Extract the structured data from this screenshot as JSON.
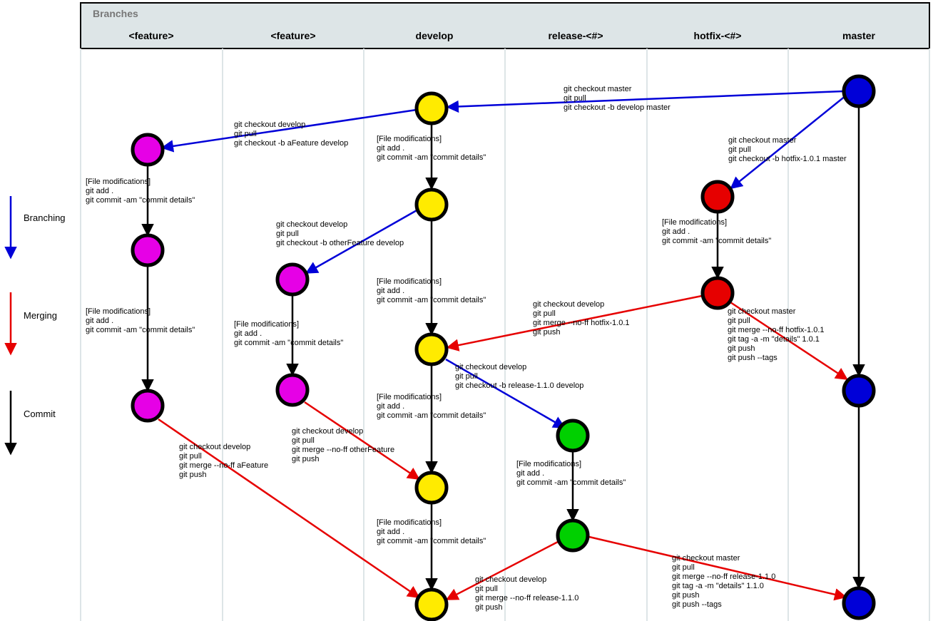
{
  "header_title": "Branches",
  "columns": [
    "<feature>",
    "<feature>",
    "develop",
    "release-<#>",
    "hotfix-<#>",
    "master"
  ],
  "legend": {
    "branching": "Branching",
    "merging": "Merging",
    "commit": "Commit"
  },
  "labels": {
    "b_dev_from_master": "git checkout master\ngit pull\ngit checkout -b develop master",
    "b_hotfix": "git checkout master\ngit pull\ngit checkout -b hotfix-1.0.1 master",
    "b_afeature": "git checkout develop\ngit pull\ngit checkout -b aFeature develop",
    "b_otherfeature": "git checkout develop\ngit pull\ngit checkout -b otherFeature develop",
    "b_release": "git checkout develop\ngit pull\ngit checkout -b release-1.1.0 develop",
    "c_dev1": "[File modifications]\ngit add .\ngit commit -am \"commit details\"",
    "c_dev2": "[File modifications]\ngit add .\ngit commit -am \"commit details\"",
    "c_dev3": "[File modifications]\ngit add .\ngit commit -am \"commit details\"",
    "c_dev4": "[File modifications]\ngit add .\ngit commit -am \"commit details\"",
    "c_af1": "[File modifications]\ngit add .\ngit commit -am \"commit details\"",
    "c_af2": "[File modifications]\ngit add .\ngit commit -am \"commit details\"",
    "c_of": "[File modifications]\ngit add .\ngit commit -am \"commit details\"",
    "c_hf": "[File modifications]\ngit add .\ngit commit -am \"commit details\"",
    "c_rel": "[File modifications]\ngit add .\ngit commit -am \"commit details\"",
    "m_hf_dev": "git checkout develop\ngit pull\ngit merge --no-ff hotfix-1.0.1\ngit push",
    "m_hf_master": "git checkout master\ngit pull\ngit merge --no-ff hotfix-1.0.1\ngit tag -a -m \"details\" 1.0.1\ngit push\ngit push --tags",
    "m_af": "git checkout develop\ngit pull\ngit merge --no-ff aFeature\ngit push",
    "m_of": "git checkout develop\ngit pull\ngit merge --no-ff otherFeature\ngit push",
    "m_rel_dev": "git checkout develop\ngit pull\ngit merge --no-ff release-1.1.0\ngit push",
    "m_rel_master": "git checkout master\ngit pull\ngit merge --no-ff release-1.1.0\ngit tag -a -m \"details\" 1.1.0\ngit push\ngit push --tags"
  },
  "colors": {
    "feature": "#e600e6",
    "develop": "#ffeb00",
    "release": "#00d000",
    "hotfix": "#e60000",
    "master": "#0000d8",
    "branch_arrow": "#0000d8",
    "merge_arrow": "#e60000",
    "commit_arrow": "#000"
  }
}
